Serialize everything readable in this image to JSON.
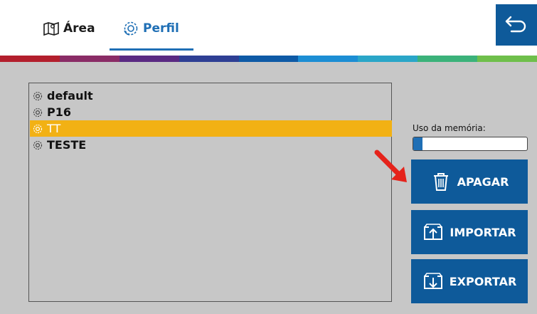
{
  "tabs": [
    {
      "label": "Área",
      "icon": "map-icon",
      "active": false
    },
    {
      "label": "Perfil",
      "icon": "profile-gear-icon",
      "active": true
    }
  ],
  "header": {
    "back_icon": "return-arrow-icon"
  },
  "rainbow_colors": [
    "#b31f2d",
    "#8a2c66",
    "#5a2a83",
    "#2e3f94",
    "#0e5aa6",
    "#1c8ed4",
    "#2aa6c8",
    "#3bb27a",
    "#6fbf4b"
  ],
  "profiles": {
    "items": [
      {
        "label": "default",
        "selected": false
      },
      {
        "label": "P16",
        "selected": false
      },
      {
        "label": "TT",
        "selected": true
      },
      {
        "label": "TESTE",
        "selected": false
      }
    ]
  },
  "memory": {
    "label": "Uso da memória:",
    "usage_fraction": 0.08
  },
  "actions": {
    "delete_label": "APAGAR",
    "import_label": "IMPORTAR",
    "export_label": "EXPORTAR"
  },
  "colors": {
    "accent": "#1f6fb5",
    "button": "#0e5a9a",
    "selection": "#f2b114",
    "pointer_arrow": "#e5231b"
  }
}
